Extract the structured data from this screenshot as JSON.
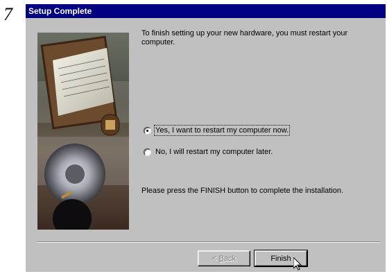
{
  "step_number": "7",
  "window": {
    "title": "Setup Complete"
  },
  "content": {
    "finish_message": "To finish setting up your new hardware, you must restart your computer.",
    "options": [
      {
        "label": "Yes, I want to restart my computer now.",
        "selected": true
      },
      {
        "label": "No, I will restart my computer later.",
        "selected": false
      }
    ],
    "press_message": "Please press the FINISH button to complete the installation."
  },
  "buttons": {
    "back_prefix": "< ",
    "back_label": "Back",
    "finish_label": "Finish"
  },
  "colors": {
    "title_bar": "#000080",
    "dialog_face": "#c0c0c0"
  },
  "icons": [
    "radio-selected-icon",
    "radio-unselected-icon",
    "mouse-pointer-icon"
  ]
}
